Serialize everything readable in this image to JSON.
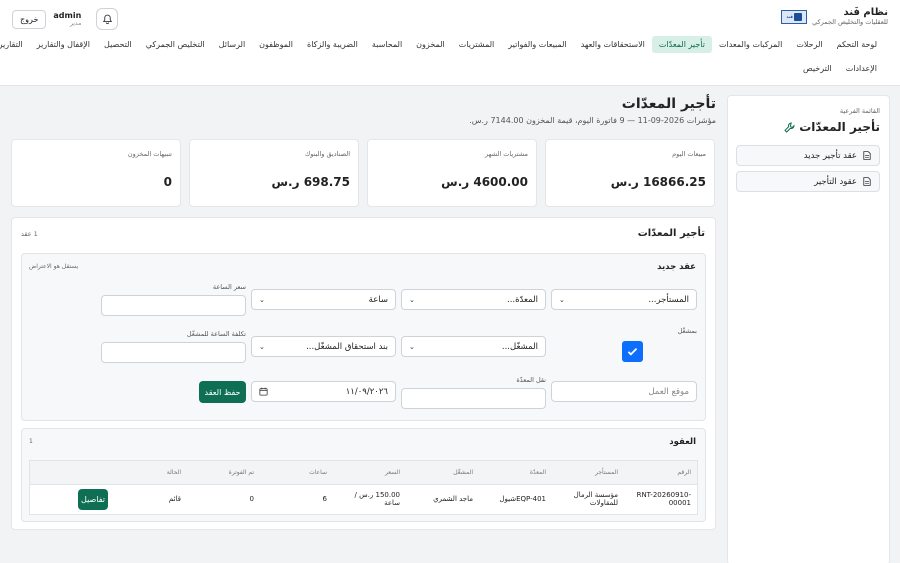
{
  "brand": {
    "title": "نظام فَند",
    "subtitle": "للعقليات والتخليص الجمركي",
    "logo_text": "فَند"
  },
  "user": {
    "name": "admin",
    "role": "مدير",
    "logout_label": "خروج"
  },
  "nav": {
    "row1": [
      "لوحة التحكم",
      "الرحلات",
      "المركبات والمعدات",
      "تأجير المعدّات",
      "الاستحقاقات والعهد",
      "المبيعات والفواتير",
      "المشتريات",
      "المخزون",
      "المحاسبة",
      "الضريبة والزكاة",
      "الموظفون",
      "الرسائل",
      "التخليص الجمركي",
      "التحصيل",
      "الإقفال والتقارير",
      "التقارير"
    ],
    "row2": [
      "الإعدادات",
      "الترخيص"
    ],
    "active_index": 3
  },
  "sidebar": {
    "label": "القائمة الفرعية",
    "title": "تأجير المعدّات",
    "items": [
      "عقد تأجير جديد",
      "عقود التأجير"
    ]
  },
  "header": {
    "title": "تأجير المعدّات",
    "subtitle": "مؤشرات 2026-09-11 — 9 فاتورة اليوم، قيمة المخزون 7144.00 ر.س."
  },
  "stats": [
    {
      "label": "مبيعات اليوم",
      "value": "16866.25 ر.س"
    },
    {
      "label": "مشتريات الشهر",
      "value": "4600.00 ر.س"
    },
    {
      "label": "الصناديق والبنوك",
      "value": "698.75 ر.س"
    },
    {
      "label": "تنبيهات المخزون",
      "value": "0"
    }
  ],
  "panel": {
    "title": "تأجير المعدّات",
    "count": "1 عقد"
  },
  "form": {
    "title": "عقد جديد",
    "note": "يستقل هو الاعتراض",
    "renter": "المستأجر...",
    "equipment": "المعدّة...",
    "unit": "ساعة",
    "rate_label": "سعر الساعة",
    "subcontract_label": "بمشغّل",
    "operator": "المشغّل...",
    "operator_item": "بند استحقاق المشغّل...",
    "operator_cost_label": "تكلفة الساعة للمشغّل",
    "site_placeholder": "موقع العمل",
    "transport_label": "نقل المعدّة",
    "date": "١١/٠٩/٢٠٢٦",
    "save_label": "حفظ العقد"
  },
  "contracts": {
    "title": "العقود",
    "count": "1",
    "columns": [
      "الرقم",
      "المستأجر",
      "المعدّة",
      "المشغّل",
      "السعر",
      "ساعات",
      "تم الفوترة",
      "الحالة",
      ""
    ],
    "rows": [
      {
        "no": "RNT-20260910-00001",
        "renter": "مؤسسة الرمال للمقاولات",
        "equipment": "EQP-401شيول",
        "operator": "ماجد الشمري",
        "price": "150.00 ر.س / ساعة",
        "hours": "6",
        "billed": "0",
        "status": "قائم",
        "action": "تفاصيل"
      }
    ]
  }
}
